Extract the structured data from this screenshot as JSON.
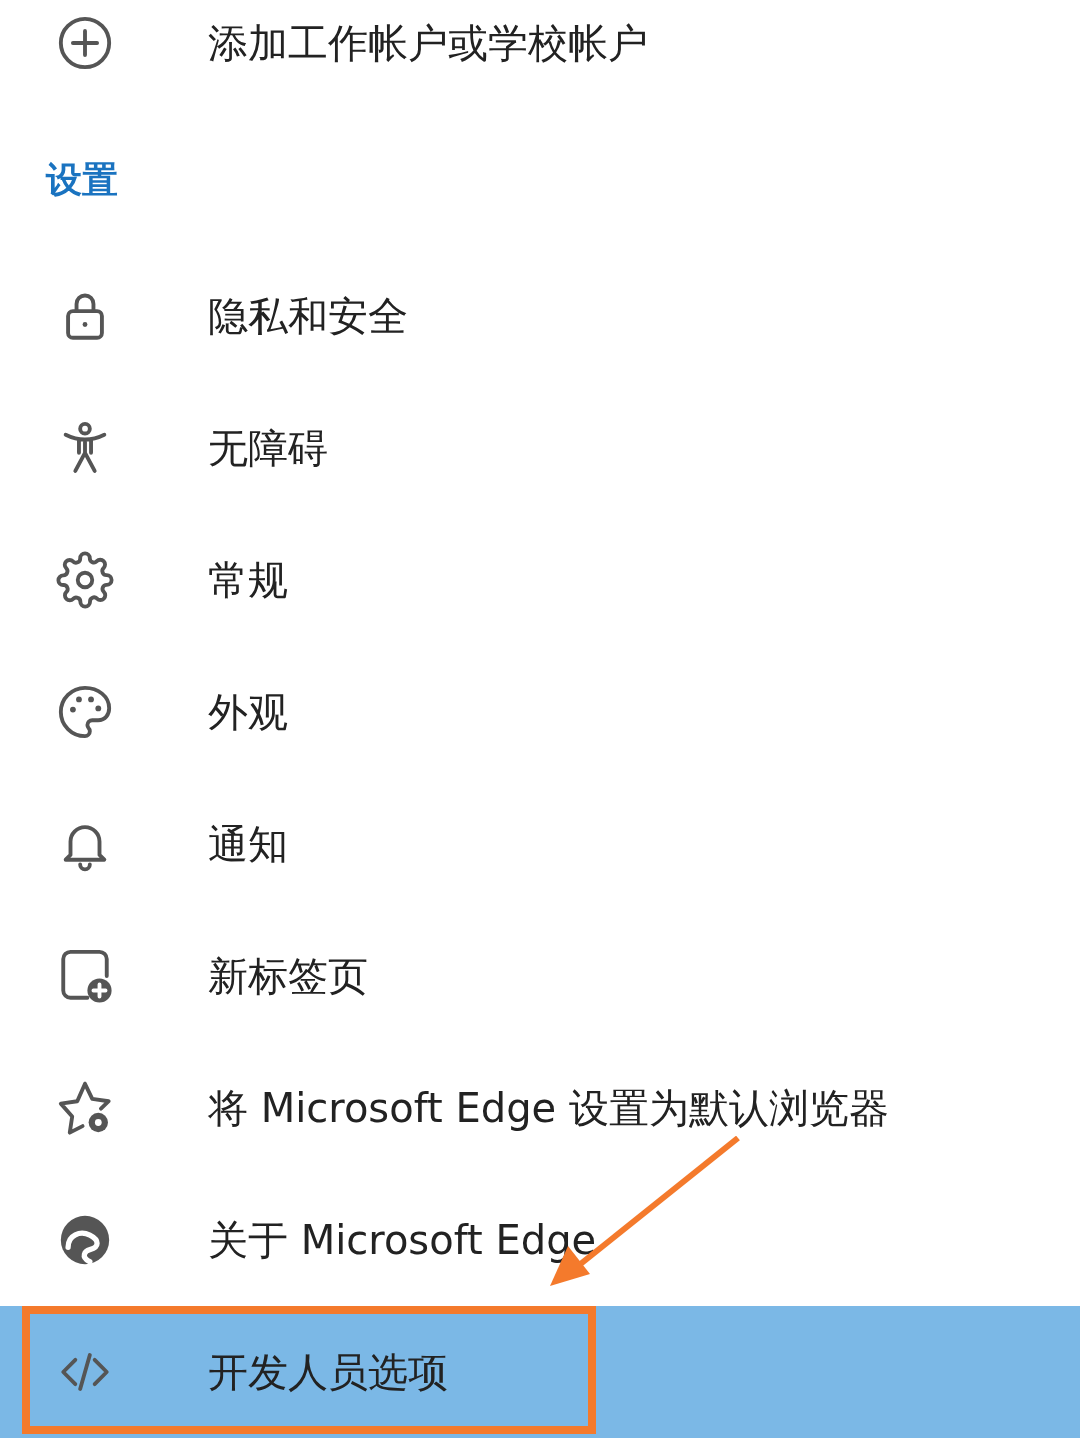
{
  "account_action": {
    "label": "添加工作帐户或学校帐户"
  },
  "section_title": "设置",
  "items": [
    {
      "kind": "lock",
      "label": "隐私和安全",
      "selected": false,
      "annotated": false
    },
    {
      "kind": "accessibility",
      "label": "无障碍",
      "selected": false,
      "annotated": false
    },
    {
      "kind": "gear",
      "label": "常规",
      "selected": false,
      "annotated": false
    },
    {
      "kind": "palette",
      "label": "外观",
      "selected": false,
      "annotated": false
    },
    {
      "kind": "bell",
      "label": "通知",
      "selected": false,
      "annotated": false
    },
    {
      "kind": "newtab",
      "label": "新标签页",
      "selected": false,
      "annotated": false
    },
    {
      "kind": "stargear",
      "label": "将 Microsoft Edge 设置为默认浏览器",
      "selected": false,
      "annotated": false
    },
    {
      "kind": "swirl",
      "label": "关于 Microsoft Edge",
      "selected": false,
      "annotated": false
    },
    {
      "kind": "code",
      "label": "开发人员选项",
      "selected": true,
      "annotated": true
    }
  ]
}
